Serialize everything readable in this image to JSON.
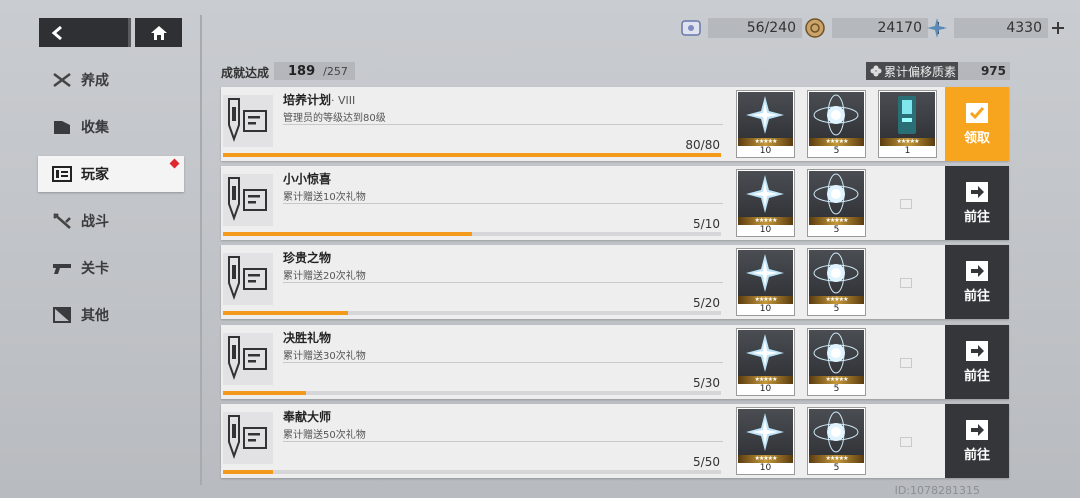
{
  "nav": {
    "back": "back-arrow-icon",
    "home": "home-icon"
  },
  "sidebar": {
    "items": [
      {
        "label": "养成",
        "icon": "crossed-swords-icon"
      },
      {
        "label": "收集",
        "icon": "folder-icon"
      },
      {
        "label": "玩家",
        "icon": "id-card-icon",
        "active": true
      },
      {
        "label": "战斗",
        "icon": "battle-icon"
      },
      {
        "label": "关卡",
        "icon": "gun-icon"
      },
      {
        "label": "其他",
        "icon": "misc-icon"
      }
    ]
  },
  "resources": [
    {
      "icon": "ticket-icon",
      "value": "56/240"
    },
    {
      "icon": "coin-icon",
      "value": "24170"
    },
    {
      "icon": "crystal-icon",
      "value": "4330"
    }
  ],
  "header": {
    "achieved_label": "成就达成",
    "achieved": "189",
    "total": "/257",
    "offset_label": "累计偏移质素",
    "offset_value": "975"
  },
  "rows": [
    {
      "title": "培养计划",
      "sub": "· VIII",
      "desc": "管理员的等级达到80级",
      "progress_text": "80/80",
      "progress": 1.0,
      "rewards": [
        "10",
        "5",
        "1"
      ],
      "action": "领取",
      "action_type": "claim"
    },
    {
      "title": "小小惊喜",
      "sub": "",
      "desc": "累计赠送10次礼物",
      "progress_text": "5/10",
      "progress": 0.5,
      "rewards": [
        "10",
        "5"
      ],
      "action": "前往",
      "action_type": "go"
    },
    {
      "title": "珍贵之物",
      "sub": "",
      "desc": "累计赠送20次礼物",
      "progress_text": "5/20",
      "progress": 0.25,
      "rewards": [
        "10",
        "5"
      ],
      "action": "前往",
      "action_type": "go"
    },
    {
      "title": "决胜礼物",
      "sub": "",
      "desc": "累计赠送30次礼物",
      "progress_text": "5/30",
      "progress": 0.1667,
      "rewards": [
        "10",
        "5"
      ],
      "action": "前往",
      "action_type": "go"
    },
    {
      "title": "奉献大师",
      "sub": "",
      "desc": "累计赠送50次礼物",
      "progress_text": "5/50",
      "progress": 0.1,
      "rewards": [
        "10",
        "5"
      ],
      "action": "前往",
      "action_type": "go"
    }
  ],
  "uid": "ID:1078281315",
  "colors": {
    "accent": "#f7a51e",
    "progress": "#f39a1d",
    "dark": "#35363a",
    "badge": "#e0262f"
  }
}
